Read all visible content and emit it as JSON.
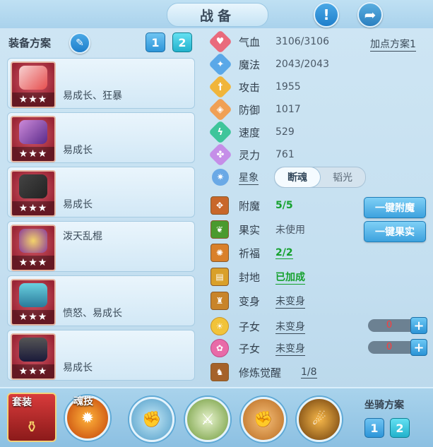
{
  "title": "战备",
  "header": {
    "alert_icon": "exclamation-icon",
    "share_icon": "share-icon"
  },
  "equip_plan": {
    "label": "装备方案",
    "edit_icon": "pencil-icon",
    "options": [
      "1",
      "2"
    ],
    "active": "2"
  },
  "slots": [
    {
      "text": "易成长、狂暴",
      "stars": "★★★",
      "icon": "weapon-icon"
    },
    {
      "text": "易成长",
      "stars": "★★★",
      "icon": "weapon-icon"
    },
    {
      "text": "易成长",
      "stars": "★★★",
      "icon": "armor-icon"
    },
    {
      "text": "泼天乱棍",
      "stars": "★★★",
      "icon": "necklace-icon"
    },
    {
      "text": "愤怒、易成长",
      "stars": "★★★",
      "icon": "belt-icon"
    },
    {
      "text": "易成长",
      "stars": "★★★",
      "icon": "boots-icon"
    }
  ],
  "stats": [
    {
      "name": "气血",
      "value": "3106/3106",
      "color": "#e96a7c",
      "glyph": "♥"
    },
    {
      "name": "魔法",
      "value": "2043/2043",
      "color": "#5aa8e8",
      "glyph": "✦"
    },
    {
      "name": "攻击",
      "value": "1955",
      "color": "#f0b53a",
      "glyph": "†"
    },
    {
      "name": "防御",
      "value": "1017",
      "color": "#f0a054",
      "glyph": "◈"
    },
    {
      "name": "速度",
      "value": "529",
      "color": "#3ec59a",
      "glyph": "ϟ"
    },
    {
      "name": "灵力",
      "value": "761",
      "color": "#c58ee8",
      "glyph": "✤"
    }
  ],
  "point_plan": "加点方案1",
  "star": {
    "label": "星象",
    "options": [
      "断魂",
      "韬光"
    ],
    "active": "断魂"
  },
  "extras": [
    {
      "name": "附魔",
      "value": "5/5",
      "style": "green",
      "icon_color": "#c8672a"
    },
    {
      "name": "果实",
      "value": "未使用",
      "style": "plain",
      "icon_color": "#4a9a2e"
    },
    {
      "name": "祈福",
      "value": "2/2",
      "style": "green-link",
      "icon_color": "#d9802a"
    },
    {
      "name": "封地",
      "value": "已加成",
      "style": "green-link",
      "icon_color": "#d9a02a"
    },
    {
      "name": "变身",
      "value": "未变身",
      "style": "link",
      "icon_color": "#c8842a"
    },
    {
      "name": "子女",
      "value": "未变身",
      "style": "link",
      "icon_color": "#f1c33a"
    },
    {
      "name": "子女",
      "value": "未变身",
      "style": "link",
      "icon_color": "#e86aa8"
    },
    {
      "name": "修炼觉醒",
      "value": "1/8",
      "style": "link",
      "icon_color": "#a5622a"
    }
  ],
  "buttons": {
    "enchant": "一键附魔",
    "fruit": "一键果实"
  },
  "child_steppers": [
    {
      "value": "0"
    },
    {
      "value": "0"
    }
  ],
  "bottom": {
    "tab1": "套装",
    "tab2": "魂技",
    "mount_plan": {
      "label": "坐骑方案",
      "options": [
        "1",
        "2"
      ],
      "active": "2"
    }
  },
  "skills": [
    "fist-skill-icon",
    "sword-skill-icon",
    "fist-skill-icon",
    "kick-skill-icon"
  ]
}
